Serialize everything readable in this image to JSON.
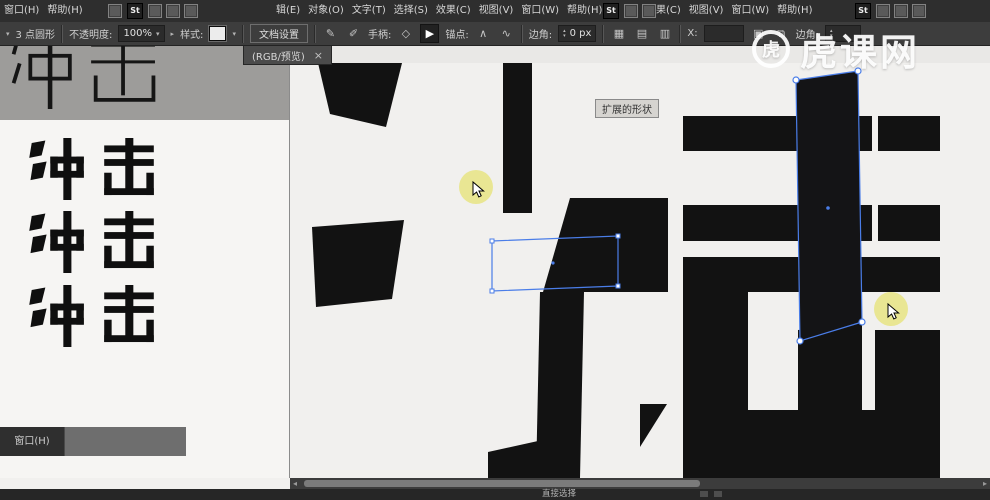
{
  "menubar": {
    "app_icon_label": "St",
    "left_items": [
      "窗口(H)",
      "帮助(H)"
    ],
    "mid_items": [
      "辑(E)",
      "对象(O)",
      "文字(T)",
      "选择(S)",
      "效果(C)",
      "视图(V)",
      "窗口(W)",
      "帮助(H)"
    ],
    "right_items": [
      "果(C)",
      "视图(V)",
      "窗口(W)",
      "帮助(H)"
    ]
  },
  "toolbar": {
    "shape_label": "3 点圆形",
    "opacity_label": "不透明度:",
    "opacity_value": "100%",
    "style_label": "样式:",
    "doc_setup_label": "文档设置",
    "handles_label": "手柄:",
    "anchors_label": "锚点:",
    "corner_label": "边角:",
    "corner_value": "0 px",
    "x_label": "X:",
    "corner2_label": "边角:"
  },
  "tab": {
    "title": "(RGB/预览)",
    "close": "×"
  },
  "left_panel": {
    "header_text": "冲击",
    "rows": [
      "冲击",
      "冲击",
      "冲击"
    ],
    "window_label": "窗口(H)"
  },
  "canvas": {
    "tooltip": "扩展的形状",
    "glyphs": [
      "冲",
      "击"
    ]
  },
  "statusbar": {
    "tool_name": "直接选择"
  },
  "watermark": {
    "logo_char": "虎",
    "text": "虎课网"
  },
  "colors": {
    "selection": "#4a7de8",
    "highlight": "#e2de49",
    "canvas_bg": "#f1f0ee"
  }
}
